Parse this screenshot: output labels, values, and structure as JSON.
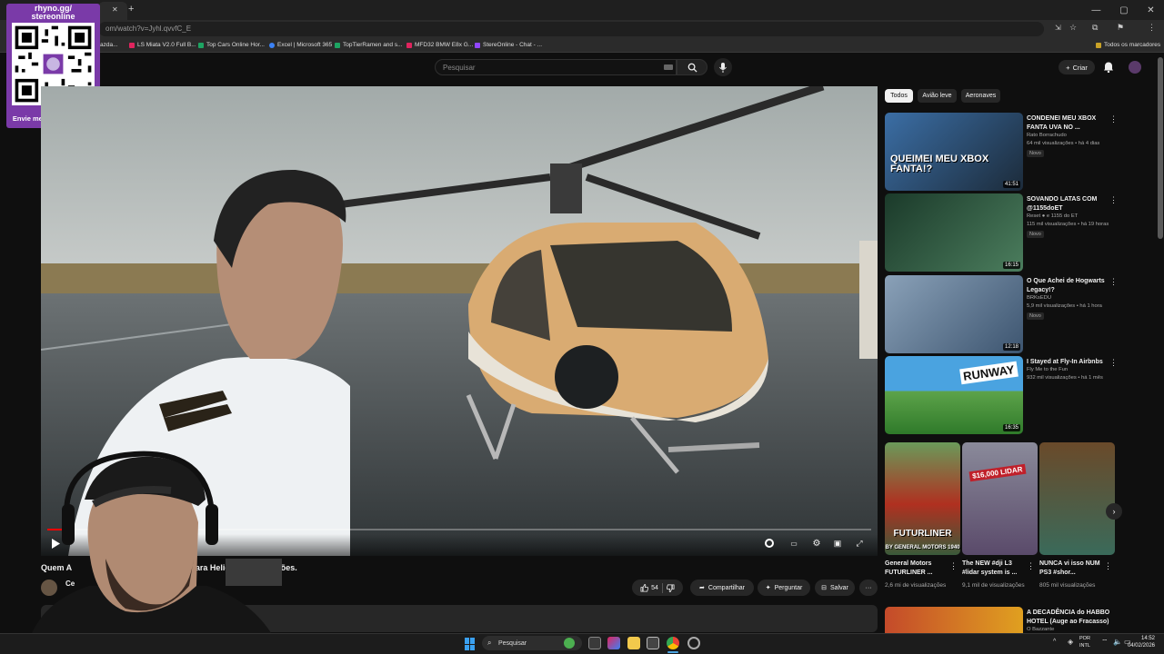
{
  "browser": {
    "url": "om/watch?v=Jyhl.qvvfC_E",
    "bookmarks": [
      {
        "label": "azda...",
        "color": "#8a8a8a"
      },
      {
        "label": "LS Miata V2.0 Full B...",
        "color": "#e0245e"
      },
      {
        "label": "Top Cars Online Hor...",
        "color": "#1da462"
      },
      {
        "label": "Excel | Microsoft 365",
        "color": "#3b82f6"
      },
      {
        "label": "TopTierRamen and s...",
        "color": "#1da462"
      },
      {
        "label": "MFD32 BMW E8x G...",
        "color": "#e0245e"
      },
      {
        "label": "StereOnline - Chat - ...",
        "color": "#9146ff"
      }
    ],
    "all_bookmarks": "Todos os marcadores"
  },
  "overlay": {
    "handle": "rhyno.gg/\nstereonline",
    "message": "Envie mensagem na live!"
  },
  "header": {
    "search_placeholder": "Pesquisar",
    "create_label": "Criar"
  },
  "video": {
    "title": "Quem A                          e dos Espaços para Helicópteros e Aviões.",
    "channel": "Ce",
    "likes": "54",
    "share_label": "Compartilhar",
    "ask_label": "Perguntar",
    "save_label": "Salvar"
  },
  "sidebar": {
    "chips": [
      "Todos",
      "Avião leve",
      "Aeronaves"
    ],
    "recommendations": [
      {
        "title": "CONDENEI MEU XBOX FANTA UVA NO ...",
        "channel": "Rato Borrachudo",
        "meta": "64 mil visualizações • há 4 dias",
        "badge": "Novo",
        "duration": "41:51",
        "thumb_text": "QUEIMEI MEU XBOX FANTA!?"
      },
      {
        "title": "SOVANDO LATAS COM @1155doET",
        "channel": "Reset ● e 1155 do ET",
        "meta": "115 mil visualizações • há 19 horas",
        "badge": "Novo",
        "duration": "16:15",
        "thumb_text": ""
      },
      {
        "title": "O Que Achei de Hogwarts Legacy!?",
        "channel": "BRKsEDU",
        "meta": "5,9 mil visualizações • há 1 hora",
        "badge": "Novo",
        "duration": "12:18",
        "thumb_text": ""
      },
      {
        "title": "I Stayed at Fly-In Airbnbs",
        "channel": "Fly Me to the Fun",
        "meta": "932 mil visualizações • há 1 mês",
        "badge": "",
        "duration": "16:35",
        "thumb_text": "RUNWAY"
      }
    ],
    "shorts": [
      {
        "title": "General Motors FUTURLINER ...",
        "views": "2,6 mi de visualizações",
        "thumb_text": "FUTURLINER",
        "thumb_sub": "BY GENERAL MOTORS 1940"
      },
      {
        "title": "The NEW #dji L3 #lidar system is ...",
        "views": "9,1 mil de visualizações",
        "thumb_text": "$16,000 LIDAR"
      },
      {
        "title": "NUNCA vi isso NUM PS3 #shor...",
        "views": "805 mil visualizações",
        "thumb_text": ""
      }
    ],
    "next_rec": {
      "title": "A DECADÊNCIA do HABBO HOTEL (Auge ao Fracasso)",
      "channel": "O Bazzante"
    }
  },
  "taskbar": {
    "search_label": "Pesquisar",
    "lang": "POR\nINTL",
    "time": "14:52",
    "date": "04/02/2026"
  },
  "colors": {
    "accent_red": "#ff0000",
    "overlay_purple": "#7a3aa8",
    "background": "#0f0f0f"
  }
}
